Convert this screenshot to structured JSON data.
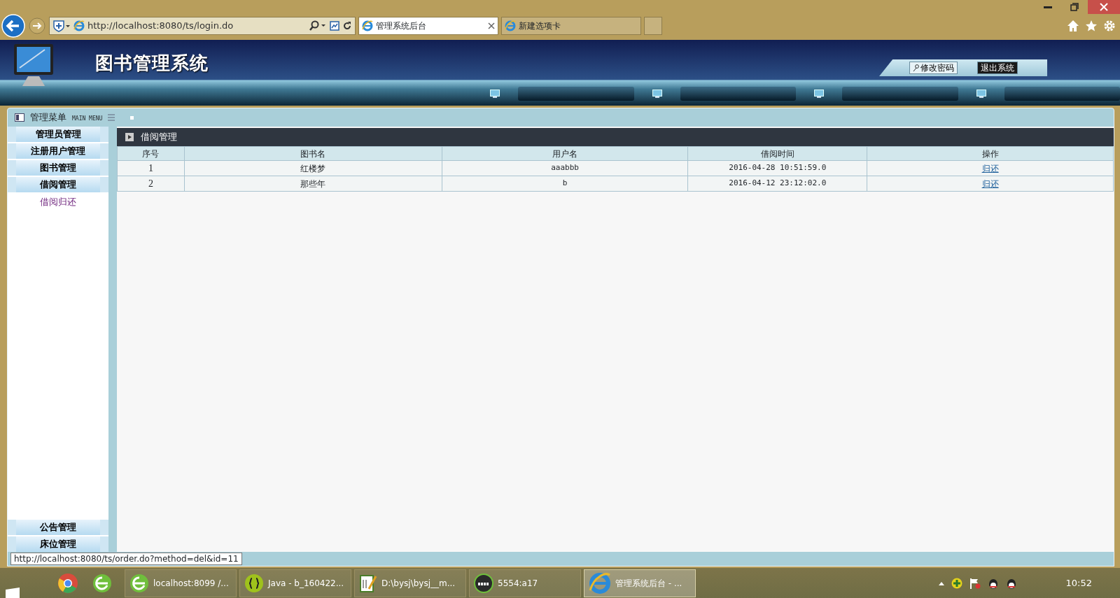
{
  "browser": {
    "address": "http://localhost:8080/ts/login.do",
    "tabs": [
      {
        "label": "管理系统后台",
        "selected": true
      },
      {
        "label": "新建选项卡",
        "selected": false
      }
    ]
  },
  "app": {
    "title": "图书管理系统",
    "buttons": [
      {
        "label": "修改密码",
        "kind": "key"
      },
      {
        "label": "退出系统",
        "kind": "dark"
      }
    ]
  },
  "menu": {
    "title": "管理菜单",
    "subtitle": "MAIN MENU",
    "items": [
      {
        "label": "管理员管理"
      },
      {
        "label": "注册用户管理"
      },
      {
        "label": "图书管理"
      },
      {
        "label": "借阅管理",
        "children": [
          {
            "label": "借阅归还"
          }
        ]
      }
    ],
    "bottom_items": [
      {
        "label": "公告管理"
      },
      {
        "label": "床位管理"
      }
    ]
  },
  "content": {
    "title": "借阅管理",
    "table": {
      "columns": [
        "序号",
        "图书名",
        "用户名",
        "借阅时间",
        "操作"
      ],
      "rows": [
        [
          "1",
          "红楼梦",
          "aaabbb",
          "2016-04-28 10:51:59.0",
          "归还"
        ],
        [
          "2",
          "那些年",
          "b",
          "2016-04-12 23:12:02.0",
          "归还"
        ]
      ]
    }
  },
  "status_url": "http://localhost:8080/ts/order.do?method=del&id=11",
  "taskbar": {
    "tasks": [
      {
        "label": "localhost:8099 /...",
        "selected": false
      },
      {
        "label": "Java - b_160422...",
        "selected": false
      },
      {
        "label": "D:\\bysj\\bysj__m...",
        "selected": false
      },
      {
        "label": "5554:a17",
        "selected": false
      },
      {
        "label": "管理系统后台 - ...",
        "selected": true
      }
    ],
    "clock": "10:52"
  }
}
